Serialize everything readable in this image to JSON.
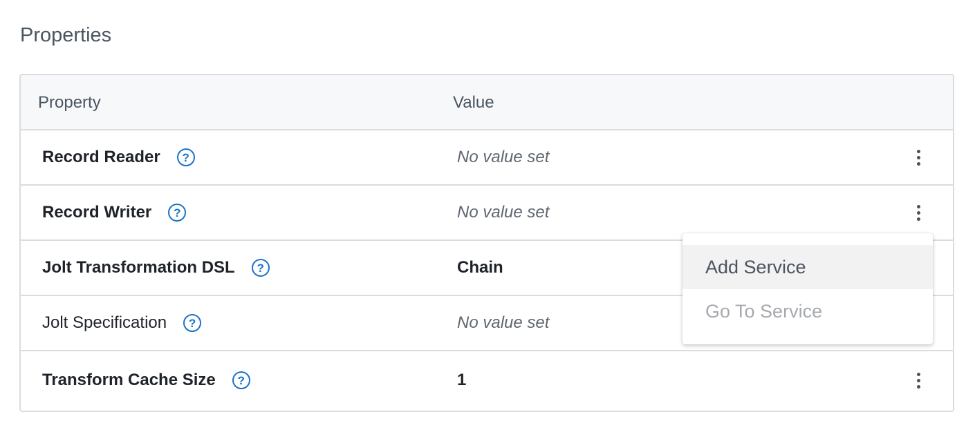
{
  "section_title": "Properties",
  "table": {
    "headers": {
      "property": "Property",
      "value": "Value"
    },
    "rows": [
      {
        "name": "Record Reader",
        "value": "No value set",
        "bold": true,
        "value_set": false,
        "has_menu": true
      },
      {
        "name": "Record Writer",
        "value": "No value set",
        "bold": true,
        "value_set": false,
        "has_menu": true
      },
      {
        "name": "Jolt Transformation DSL",
        "value": "Chain",
        "bold": true,
        "value_set": true,
        "has_menu": false
      },
      {
        "name": "Jolt Specification",
        "value": "No value set",
        "bold": false,
        "value_set": false,
        "has_menu": false
      },
      {
        "name": "Transform Cache Size",
        "value": "1",
        "bold": true,
        "value_set": true,
        "has_menu": true
      }
    ],
    "help_icon": "?"
  },
  "context_menu": {
    "items": [
      {
        "label": "Add Service",
        "state": "hover"
      },
      {
        "label": "Go To Service",
        "state": "disabled"
      }
    ]
  },
  "colors": {
    "accent": "#1a73c8",
    "text_muted": "#4a5560",
    "border": "#d9dce0",
    "header_bg": "#f7f8fa"
  }
}
